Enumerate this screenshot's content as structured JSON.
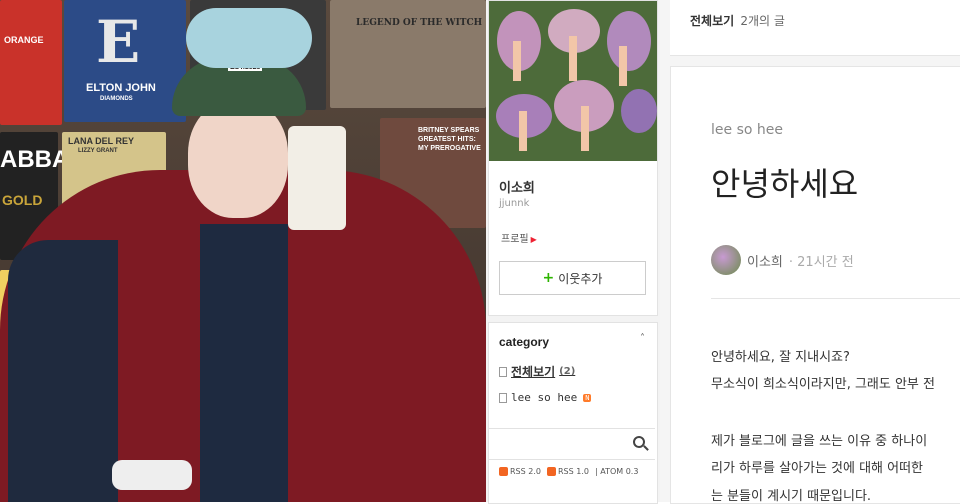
{
  "photo": {
    "records": [
      "ELTON JOHN",
      "DIAMONDS",
      "ORANGE",
      "LEGEND OF THE WITCH",
      "LANA DEL REY",
      "LIZZY GRANT",
      "ABBA",
      "GOLD",
      "BRITNEY SPEARS GREATEST HITS: MY PREROGATIVE",
      "EST.1625"
    ]
  },
  "profile": {
    "name": "이소희",
    "id": "jjunnk",
    "profile_link": "프로필",
    "add_neighbor": "이웃추가"
  },
  "category": {
    "title": "category",
    "items": [
      {
        "label": "전체보기",
        "count": "(2)"
      },
      {
        "label": "lee so hee",
        "badge": "N"
      }
    ]
  },
  "feeds": [
    "RSS 2.0",
    "RSS 1.0",
    "ATOM 0.3"
  ],
  "topbar": {
    "label": "전체보기",
    "count_text": "2개의 글"
  },
  "post": {
    "category": "lee so hee",
    "title": "안녕하세요",
    "author": "이소희",
    "time": "21시간 전",
    "paragraphs": [
      "안녕하세요, 잘 지내시죠?",
      "무소식이 희소식이라지만, 그래도 안부 전",
      "제가 블로그에 글을 쓰는 이유 중 하나이",
      "리가 하루를 살아가는 것에 대해 어떠한",
      "는 분들이 계시기 때문입니다."
    ]
  }
}
